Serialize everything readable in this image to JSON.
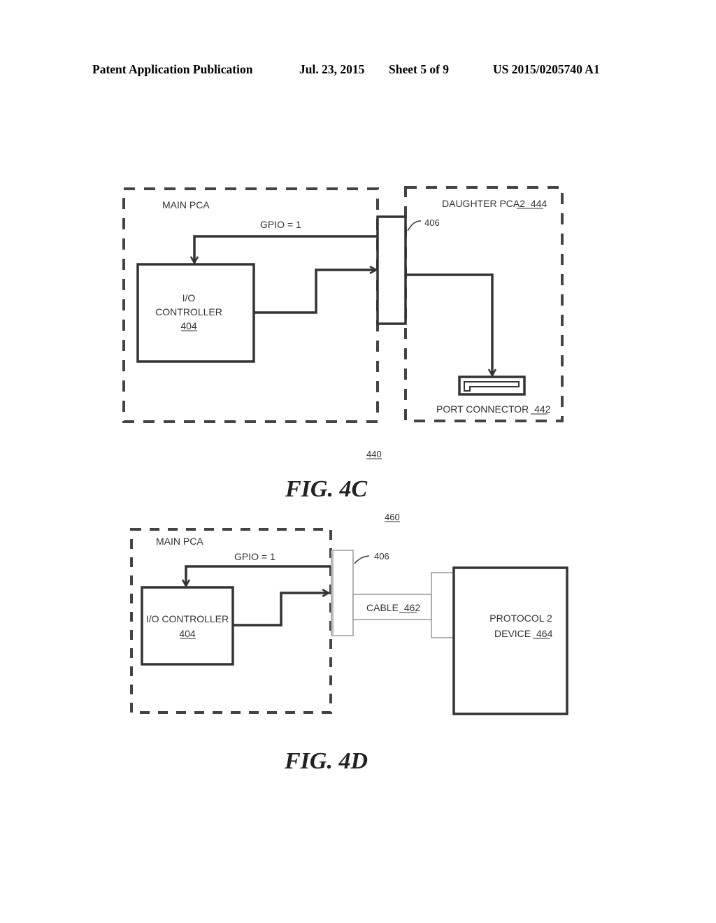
{
  "header": {
    "publication": "Patent Application Publication",
    "date": "Jul. 23, 2015",
    "sheet": "Sheet 5 of 9",
    "number": "US 2015/0205740 A1"
  },
  "fig4c": {
    "caption": "FIG. 4C",
    "ref_number": "440",
    "main_pca_label": "MAIN PCA",
    "gpio_label": "GPIO = 1",
    "io_controller_line1": "I/O",
    "io_controller_line2": "CONTROLLER",
    "io_controller_ref": "404",
    "connector_ref": "406",
    "daughter_label": "DAUGHTER PCA2",
    "daughter_ref": "444",
    "port_connector_label": "PORT CONNECTOR",
    "port_connector_ref": "442"
  },
  "fig4d": {
    "caption": "FIG. 4D",
    "ref_number": "460",
    "main_pca_label": "MAIN PCA",
    "gpio_label": "GPIO = 1",
    "io_controller_label": "I/O CONTROLLER",
    "io_controller_ref": "404",
    "connector_ref": "406",
    "cable_label": "CABLE",
    "cable_ref": "462",
    "device_line1": "PROTOCOL 2",
    "device_line2_label": "DEVICE",
    "device_ref": "464"
  }
}
